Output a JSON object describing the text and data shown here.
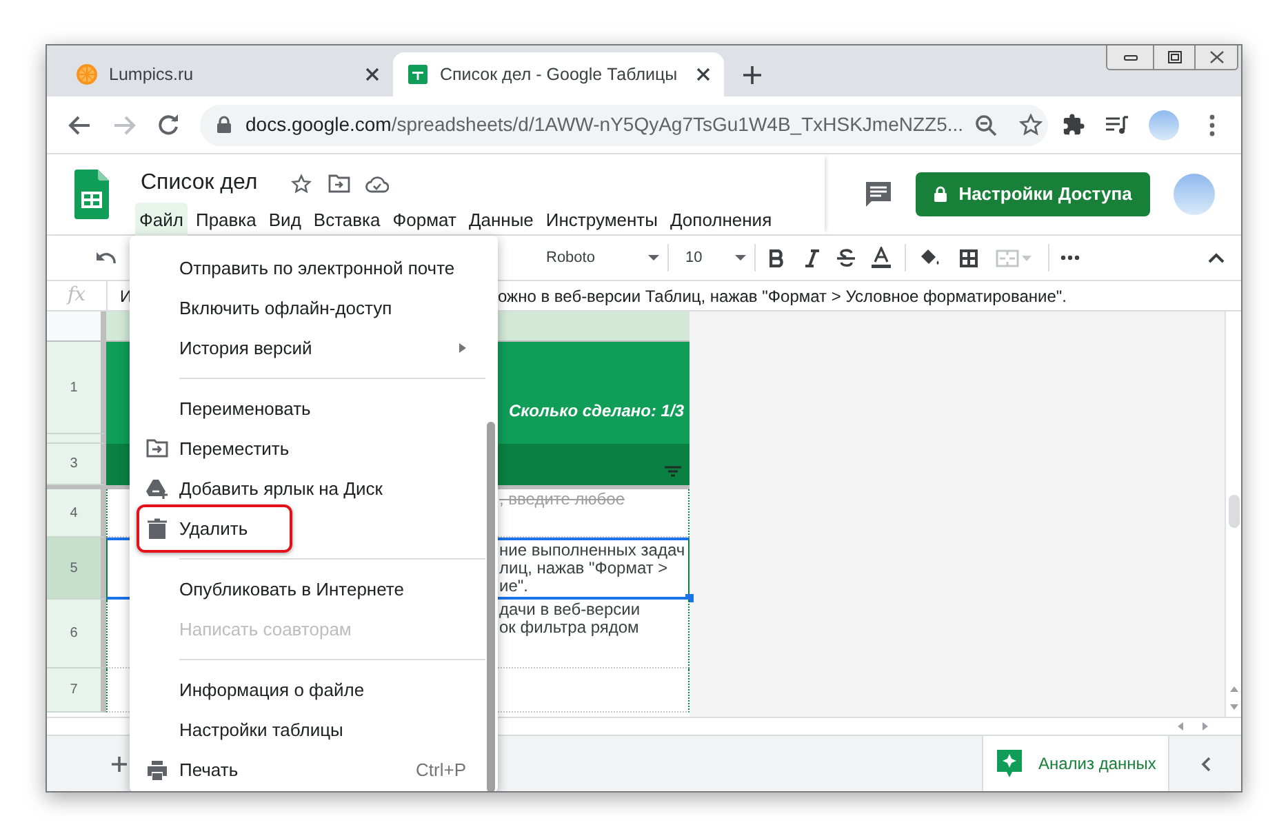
{
  "browser_tabs": [
    {
      "kind": "site",
      "title": "Lumpics.ru",
      "selected": false
    },
    {
      "kind": "sheets",
      "title": "Список дел - Google Таблицы",
      "selected": true
    }
  ],
  "address_bar": {
    "host": "docs.google.com",
    "path": "/spreadsheets/d/1AWW-nY5QyAg7TsGu1W4B_TxHSKJmeNZZ5..."
  },
  "document": {
    "title": "Список дел",
    "share_button": "Настройки Доступа",
    "menu": [
      {
        "label": "Файл",
        "selected": true
      },
      {
        "label": "Правка",
        "selected": false
      },
      {
        "label": "Вид",
        "selected": false
      },
      {
        "label": "Вставка",
        "selected": false
      },
      {
        "label": "Формат",
        "selected": false
      },
      {
        "label": "Данные",
        "selected": false
      },
      {
        "label": "Инструменты",
        "selected": false
      },
      {
        "label": "Дополнения",
        "selected": false
      }
    ]
  },
  "toolbar": {
    "font": "Roboto",
    "font_size": "10"
  },
  "formula_bar": {
    "label": "fx",
    "visible_start": "И",
    "visible_end": "ожно в веб-версии Таблиц, нажав \"Формат > Условное форматирование\"."
  },
  "sheet": {
    "rows": [
      {
        "kind": "title",
        "number": "1",
        "text": "Сколько сделано: 1/3",
        "selected": false
      },
      {
        "kind": "spacer",
        "selected": false
      },
      {
        "kind": "header",
        "number": "3",
        "selected": false
      },
      {
        "kind": "task",
        "number": "4",
        "text": ", введите любое",
        "done": true,
        "selected": false
      },
      {
        "kind": "task",
        "number": "5",
        "text": "ние выполненных задач\nлиц, нажав \"Формат >\nие\".",
        "done": false,
        "selected": true
      },
      {
        "kind": "task",
        "number": "6",
        "text": "дачи в веб-версии\nок фильтра рядом",
        "done": false,
        "selected": false
      },
      {
        "kind": "task",
        "number": "7",
        "selected": false
      }
    ]
  },
  "file_menu": {
    "items": [
      {
        "kind": "item",
        "label": "Отправить по электронной почте",
        "disabled": false,
        "highlighted": false
      },
      {
        "kind": "item",
        "label": "Включить офлайн-доступ",
        "disabled": false,
        "highlighted": false
      },
      {
        "kind": "item",
        "label": "История версий",
        "submenu": true,
        "disabled": false,
        "highlighted": false
      },
      {
        "kind": "divider"
      },
      {
        "kind": "item",
        "label": "Переименовать",
        "disabled": false,
        "highlighted": false
      },
      {
        "kind": "item",
        "label": "Переместить",
        "disabled": false,
        "highlighted": false
      },
      {
        "kind": "item",
        "label": "Добавить ярлык на Диск",
        "disabled": false,
        "highlighted": false
      },
      {
        "kind": "item",
        "label": "Удалить",
        "disabled": false,
        "highlighted": true
      },
      {
        "kind": "divider"
      },
      {
        "kind": "item",
        "label": "Опубликовать в Интернете",
        "disabled": false,
        "highlighted": false
      },
      {
        "kind": "item",
        "label": "Написать соавторам",
        "disabled": true,
        "highlighted": false
      },
      {
        "kind": "divider"
      },
      {
        "kind": "item",
        "label": "Информация о файле",
        "disabled": false,
        "highlighted": false
      },
      {
        "kind": "item",
        "label": "Настройки таблицы",
        "disabled": false,
        "highlighted": false
      },
      {
        "kind": "item",
        "label": "Печать",
        "shortcut": "Ctrl+P",
        "disabled": false,
        "highlighted": false
      }
    ]
  },
  "bottom_bar": {
    "explore_button": "Анализ данных"
  }
}
